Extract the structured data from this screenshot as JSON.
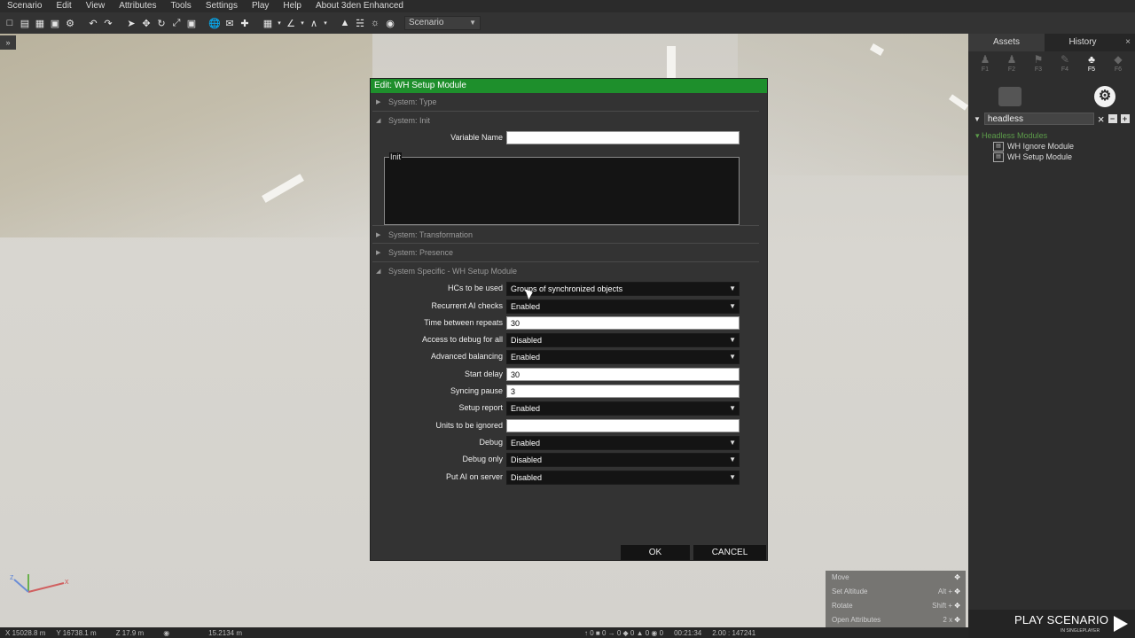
{
  "menubar": {
    "items": [
      "Scenario",
      "Edit",
      "View",
      "Attributes",
      "Tools",
      "Settings",
      "Play",
      "Help",
      "About 3den Enhanced"
    ]
  },
  "toolbar": {
    "scenario_select": "Scenario"
  },
  "right_panel": {
    "tabs": [
      "Assets",
      "History"
    ],
    "icon_labels": [
      "F1",
      "F2",
      "F3",
      "F4",
      "F5",
      "F6"
    ],
    "search": {
      "value": "headless"
    },
    "tree": {
      "category": "Headless Modules",
      "items": [
        "WH Ignore Module",
        "WH Setup Module"
      ]
    }
  },
  "play": {
    "label": "PLAY SCENARIO",
    "sub": "IN SINGLEPLAYER"
  },
  "hints": [
    {
      "action": "Move",
      "key": ""
    },
    {
      "action": "Set Altitude",
      "key": "Alt +"
    },
    {
      "action": "Rotate",
      "key": "Shift +"
    },
    {
      "action": "Open Attributes",
      "key": "2 x"
    }
  ],
  "statusbar": {
    "x": "15028.8 m",
    "y": "16738.1 m",
    "z": "17.9 m",
    "dist": "15.2134 m",
    "time": "00:21:34",
    "ratio": "2.00 : 147241",
    "counts": [
      "0",
      "0",
      "0",
      "0",
      "0",
      "0"
    ]
  },
  "dialog": {
    "title": "Edit: WH Setup Module",
    "sections": {
      "type": "System: Type",
      "init": "System: Init",
      "transformation": "System: Transformation",
      "presence": "System: Presence",
      "specific": "System Specific - WH Setup Module"
    },
    "init": {
      "variable_name_label": "Variable Name",
      "variable_name": "",
      "init_label": "Init"
    },
    "fields": [
      {
        "label": "HCs to be used",
        "value": "Groups of synchronized objects",
        "kind": "select"
      },
      {
        "label": "Recurrent AI checks",
        "value": "Enabled",
        "kind": "select"
      },
      {
        "label": "Time between repeats",
        "value": "30",
        "kind": "text"
      },
      {
        "label": "Access to debug for all",
        "value": "Disabled",
        "kind": "select"
      },
      {
        "label": "Advanced balancing",
        "value": "Enabled",
        "kind": "select"
      },
      {
        "label": "Start delay",
        "value": "30",
        "kind": "text"
      },
      {
        "label": "Syncing pause",
        "value": "3",
        "kind": "text"
      },
      {
        "label": "Setup report",
        "value": "Enabled",
        "kind": "select"
      },
      {
        "label": "Units to be ignored",
        "value": "",
        "kind": "text"
      },
      {
        "label": "Debug",
        "value": "Enabled",
        "kind": "select"
      },
      {
        "label": "Debug only",
        "value": "Disabled",
        "kind": "select"
      },
      {
        "label": "Put AI on server",
        "value": "Disabled",
        "kind": "select"
      }
    ],
    "buttons": {
      "ok": "OK",
      "cancel": "CANCEL"
    }
  },
  "colors": {
    "title_bar": "#1e8f2c",
    "panel_bg": "#333333",
    "field_bg": "#141414"
  }
}
